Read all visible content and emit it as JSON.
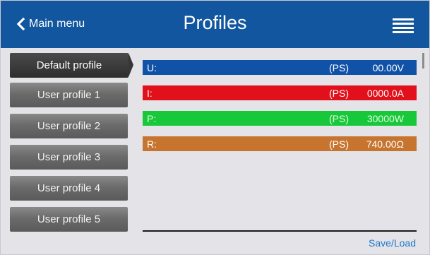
{
  "header": {
    "back_label": "Main menu",
    "title": "Profiles",
    "menu_icon": "hamburger-menu-icon",
    "background_color": "#11569e"
  },
  "profiles": [
    {
      "label": "Default profile",
      "active": true
    },
    {
      "label": "User profile 1",
      "active": false
    },
    {
      "label": "User profile 2",
      "active": false
    },
    {
      "label": "User profile 3",
      "active": false
    },
    {
      "label": "User profile 4",
      "active": false
    },
    {
      "label": "User profile 5",
      "active": false
    }
  ],
  "values": [
    {
      "label": "U:",
      "source": "(PS)",
      "value": "00.00V",
      "color": "#1052a8"
    },
    {
      "label": "I:",
      "source": "(PS)",
      "value": "0000.0A",
      "color": "#e1101a"
    },
    {
      "label": "P:",
      "source": "(PS)",
      "value": "30000W",
      "color": "#18c83a"
    },
    {
      "label": "R:",
      "source": "(PS)",
      "value": "740.00Ω",
      "color": "#c7742e"
    }
  ],
  "footer": {
    "save_load_label": "Save/Load",
    "link_color": "#1f79c8"
  }
}
